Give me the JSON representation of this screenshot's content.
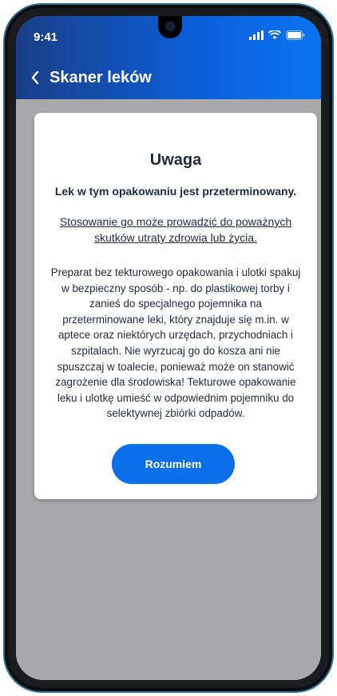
{
  "status_bar": {
    "time": "9:41"
  },
  "header": {
    "back_icon": "chevron-left-icon",
    "title": "Skaner leków"
  },
  "modal": {
    "title": "Uwaga",
    "subtitle": "Lek w tym opakowaniu jest przeterminowany.",
    "warning": "Stosowanie go może prowadzić do poważnych skutków utraty zdrowia lub życia.",
    "body": "Preparat bez tekturowego opakowania i ulotki spakuj w bezpieczny sposób - np. do plastikowej torby i zanieś do specjalnego pojemnika na przeterminowane leki, który znajduje się m.in. w aptece oraz niektórych urzędach, przychodniach i szpitalach. Nie wyrzucaj go do kosza ani nie spuszczaj w toalecie, ponieważ może on stanowić zagrożenie dla środowiska! Tekturowe opakowanie leku i ulotkę umieść w odpowiednim pojemniku do selektywnej zbiórki odpadów.",
    "button_label": "Rozumiem"
  },
  "colors": {
    "header_start": "#1a3e87",
    "header_end": "#0a74f0",
    "button": "#0a6fe8",
    "overlay": "#a9a9ab"
  }
}
